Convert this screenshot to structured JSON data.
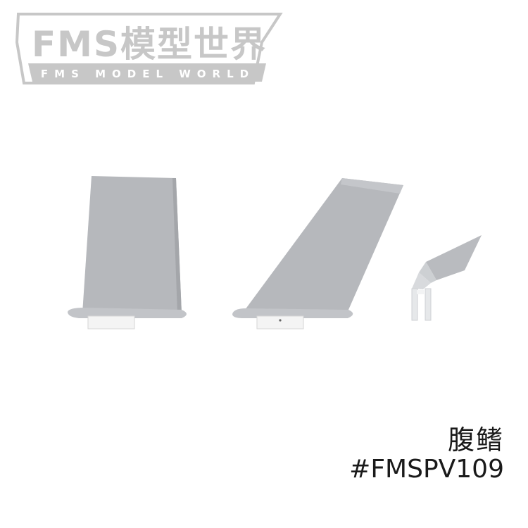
{
  "logo": {
    "title": "FMS模型世界",
    "subtitle": "FMS MODEL WORLD",
    "color": "#c7c7c7"
  },
  "product": {
    "name": "腹鳍",
    "code": "#FMSPV109"
  },
  "colors": {
    "part_fill": "#b6b8bc",
    "part_shade": "#a4a6aa",
    "clip_fill": "#f4f4f4",
    "background": "#ffffff"
  }
}
